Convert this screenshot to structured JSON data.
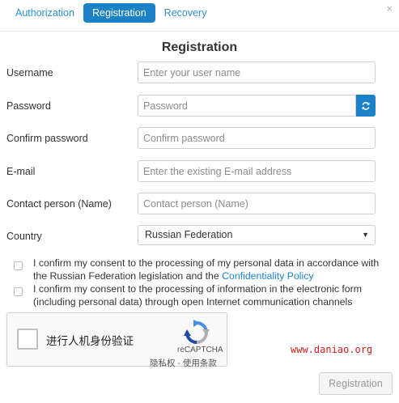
{
  "tabs": [
    {
      "label": "Authorization",
      "active": false
    },
    {
      "label": "Registration",
      "active": true
    },
    {
      "label": "Recovery",
      "active": false
    }
  ],
  "close_symbol": "×",
  "form": {
    "title": "Registration",
    "username": {
      "label": "Username",
      "placeholder": "Enter your user name",
      "value": ""
    },
    "password": {
      "label": "Password",
      "placeholder": "Password",
      "value": "",
      "regenerate_icon": "refresh-icon"
    },
    "confirm_password": {
      "label": "Confirm password",
      "placeholder": "Confirm password",
      "value": ""
    },
    "email": {
      "label": "E-mail",
      "placeholder": "Enter the existing E-mail address",
      "value": ""
    },
    "contact_person": {
      "label": "Contact person (Name)",
      "placeholder": "Contact person (Name)",
      "value": ""
    },
    "country": {
      "label": "Country",
      "selected": "Russian Federation",
      "arrow": "▼"
    }
  },
  "consents": [
    {
      "text": "I confirm my consent to the processing of my personal data in accordance with the Russian Federation legislation and the ",
      "link": "Confidentiality Policy",
      "checked": false
    },
    {
      "text": "I confirm my consent to the processing of information in the electronic form (including personal data) through open Internet communication channels",
      "checked": false
    }
  ],
  "recaptcha": {
    "label": "进行人机身份验证",
    "brand": "reCAPTCHA",
    "privacy": "隐私权",
    "separator": " - ",
    "terms": "使用条款"
  },
  "watermark": "www.daniao.org",
  "submit_label": "Registration",
  "colors": {
    "accent": "#1c82c8",
    "link": "#2a8fd0",
    "watermark": "#d02020"
  }
}
